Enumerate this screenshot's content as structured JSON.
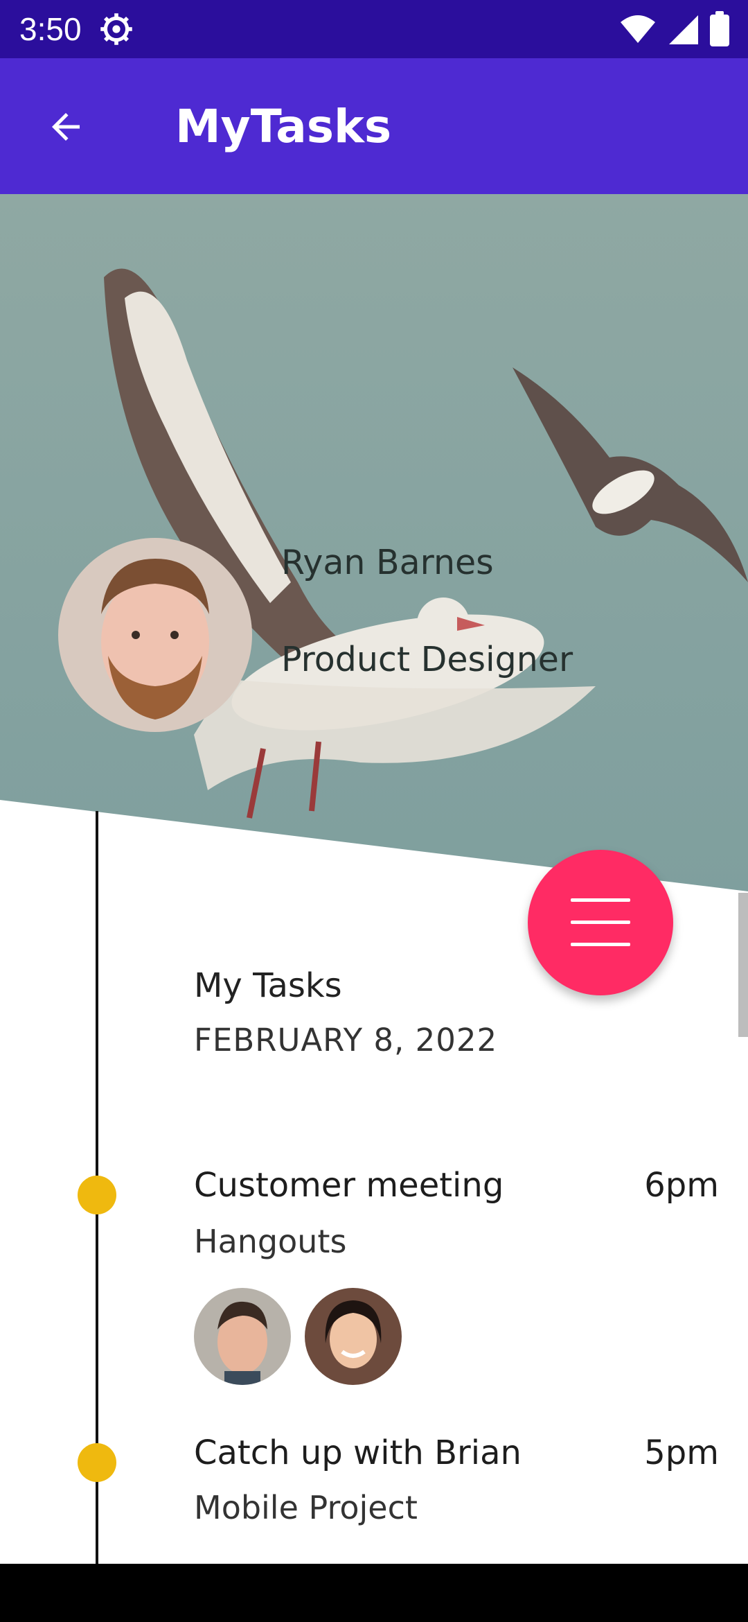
{
  "status_bar": {
    "time": "3:50",
    "icons": [
      "settings-gear-icon",
      "wifi-icon",
      "cell-signal-icon",
      "battery-icon"
    ]
  },
  "app_bar": {
    "title": "MyTasks",
    "back_icon": "arrow-back-icon"
  },
  "profile": {
    "name": "Ryan Barnes",
    "role": "Product Designer"
  },
  "fab": {
    "icon": "menu-icon",
    "color": "#ff2b64"
  },
  "timeline": {
    "title": "My Tasks",
    "date": "FEBRUARY 8, 2022",
    "tasks": [
      {
        "title": "Customer meeting",
        "time": "6pm",
        "subtitle": "Hangouts",
        "attendees": [
          "attendee-avatar-1",
          "attendee-avatar-2"
        ]
      },
      {
        "title": "Catch up with Brian",
        "time": "5pm",
        "subtitle": "Mobile Project"
      }
    ]
  },
  "colors": {
    "status_bar": "#2b0e9c",
    "app_bar": "#4e2ad2",
    "dot": "#efb90f"
  }
}
